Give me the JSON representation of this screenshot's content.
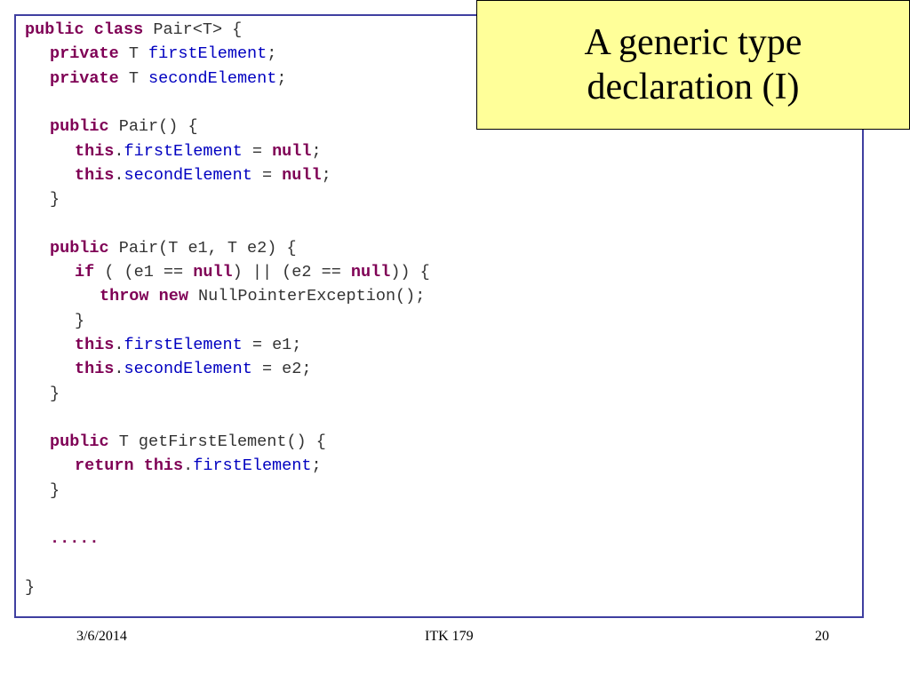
{
  "title": "A generic type declaration (I)",
  "footer": {
    "date": "3/6/2014",
    "center": "ITK 179",
    "page": "20"
  },
  "colors": {
    "keyword": "#7f0055",
    "field": "#0000c0",
    "plain": "#333333",
    "border": "#3f3fa0",
    "title_background": "#ffff99"
  },
  "code": [
    {
      "indent": 0,
      "tokens": [
        {
          "t": "kw",
          "s": "public class"
        },
        {
          "t": "plain",
          "s": " Pair<T> {"
        }
      ]
    },
    {
      "indent": 1,
      "tokens": [
        {
          "t": "kw",
          "s": "private"
        },
        {
          "t": "plain",
          "s": " T "
        },
        {
          "t": "fld",
          "s": "firstElement"
        },
        {
          "t": "plain",
          "s": ";"
        }
      ]
    },
    {
      "indent": 1,
      "tokens": [
        {
          "t": "kw",
          "s": "private"
        },
        {
          "t": "plain",
          "s": " T "
        },
        {
          "t": "fld",
          "s": "secondElement"
        },
        {
          "t": "plain",
          "s": ";"
        }
      ]
    },
    {
      "indent": 0,
      "tokens": []
    },
    {
      "indent": 1,
      "tokens": [
        {
          "t": "kw",
          "s": "public"
        },
        {
          "t": "plain",
          "s": " Pair() {"
        }
      ]
    },
    {
      "indent": 2,
      "tokens": [
        {
          "t": "kw",
          "s": "this"
        },
        {
          "t": "plain",
          "s": "."
        },
        {
          "t": "fld",
          "s": "firstElement"
        },
        {
          "t": "plain",
          "s": " = "
        },
        {
          "t": "kw",
          "s": "null"
        },
        {
          "t": "plain",
          "s": ";"
        }
      ]
    },
    {
      "indent": 2,
      "tokens": [
        {
          "t": "kw",
          "s": "this"
        },
        {
          "t": "plain",
          "s": "."
        },
        {
          "t": "fld",
          "s": "secondElement"
        },
        {
          "t": "plain",
          "s": " = "
        },
        {
          "t": "kw",
          "s": "null"
        },
        {
          "t": "plain",
          "s": ";"
        }
      ]
    },
    {
      "indent": 1,
      "tokens": [
        {
          "t": "plain",
          "s": "}"
        }
      ]
    },
    {
      "indent": 0,
      "tokens": []
    },
    {
      "indent": 1,
      "tokens": [
        {
          "t": "kw",
          "s": "public"
        },
        {
          "t": "plain",
          "s": " Pair(T e1, T e2) {"
        }
      ]
    },
    {
      "indent": 2,
      "tokens": [
        {
          "t": "kw",
          "s": "if"
        },
        {
          "t": "plain",
          "s": " ( (e1 == "
        },
        {
          "t": "kw",
          "s": "null"
        },
        {
          "t": "plain",
          "s": ") || (e2 == "
        },
        {
          "t": "kw",
          "s": "null"
        },
        {
          "t": "plain",
          "s": ")) {"
        }
      ]
    },
    {
      "indent": 3,
      "tokens": [
        {
          "t": "kw",
          "s": "throw new"
        },
        {
          "t": "plain",
          "s": " NullPointerException();"
        }
      ]
    },
    {
      "indent": 2,
      "tokens": [
        {
          "t": "plain",
          "s": "}"
        }
      ]
    },
    {
      "indent": 2,
      "tokens": [
        {
          "t": "kw",
          "s": "this"
        },
        {
          "t": "plain",
          "s": "."
        },
        {
          "t": "fld",
          "s": "firstElement"
        },
        {
          "t": "plain",
          "s": " = e1;"
        }
      ]
    },
    {
      "indent": 2,
      "tokens": [
        {
          "t": "kw",
          "s": "this"
        },
        {
          "t": "plain",
          "s": "."
        },
        {
          "t": "fld",
          "s": "secondElement"
        },
        {
          "t": "plain",
          "s": " = e2;"
        }
      ]
    },
    {
      "indent": 1,
      "tokens": [
        {
          "t": "plain",
          "s": "}"
        }
      ]
    },
    {
      "indent": 0,
      "tokens": []
    },
    {
      "indent": 1,
      "tokens": [
        {
          "t": "kw",
          "s": "public"
        },
        {
          "t": "plain",
          "s": " T getFirstElement() {"
        }
      ]
    },
    {
      "indent": 2,
      "tokens": [
        {
          "t": "kw",
          "s": "return this"
        },
        {
          "t": "plain",
          "s": "."
        },
        {
          "t": "fld",
          "s": "firstElement"
        },
        {
          "t": "plain",
          "s": ";"
        }
      ]
    },
    {
      "indent": 1,
      "tokens": [
        {
          "t": "plain",
          "s": "}"
        }
      ]
    },
    {
      "indent": 0,
      "tokens": []
    },
    {
      "indent": 1,
      "tokens": [
        {
          "t": "kw",
          "s": "....."
        }
      ]
    },
    {
      "indent": 0,
      "tokens": []
    },
    {
      "indent": 0,
      "tokens": [
        {
          "t": "plain",
          "s": "}"
        }
      ]
    }
  ]
}
